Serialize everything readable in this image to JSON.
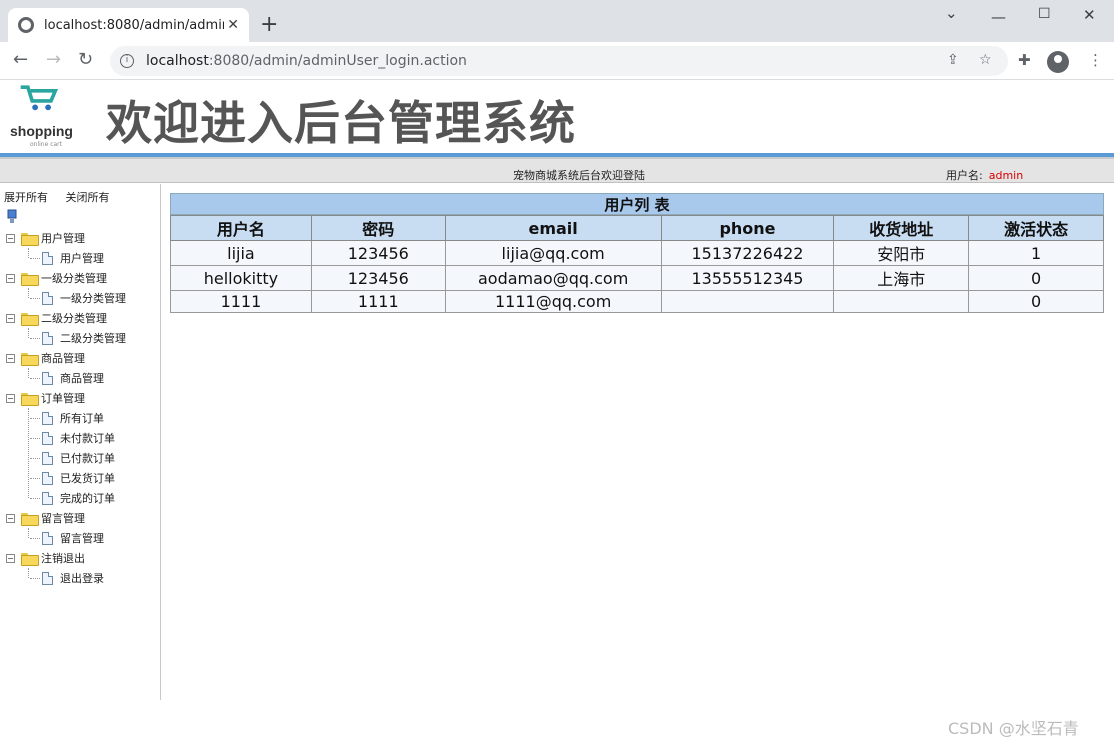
{
  "browser": {
    "tab_title": "localhost:8080/admin/adminU",
    "url_host": "localhost",
    "url_path": ":8080/admin/adminUser_login.action"
  },
  "header": {
    "logo_word": "shopping",
    "logo_sub": "online cart",
    "title": "欢迎进入后台管理系统"
  },
  "infobar": {
    "welcome": "宠物商城系统后台欢迎登陆",
    "user_label": "用户名:",
    "user_name": "admin"
  },
  "sidebar": {
    "expand_all": "展开所有",
    "collapse_all": "关闭所有",
    "groups": [
      {
        "label": "用户管理",
        "items": [
          "用户管理"
        ]
      },
      {
        "label": "一级分类管理",
        "items": [
          "一级分类管理"
        ]
      },
      {
        "label": "二级分类管理",
        "items": [
          "二级分类管理"
        ]
      },
      {
        "label": "商品管理",
        "items": [
          "商品管理"
        ]
      },
      {
        "label": "订单管理",
        "items": [
          "所有订单",
          "未付款订单",
          "已付款订单",
          "已发货订单",
          "完成的订单"
        ]
      },
      {
        "label": "留言管理",
        "items": [
          "留言管理"
        ]
      },
      {
        "label": "注销退出",
        "items": [
          "退出登录"
        ]
      }
    ]
  },
  "table": {
    "caption": "用户列 表",
    "columns": [
      "用户名",
      "密码",
      "email",
      "phone",
      "收货地址",
      "激活状态"
    ],
    "rows": [
      [
        "lijia",
        "123456",
        "lijia@qq.com",
        "15137226422",
        "安阳市",
        "1"
      ],
      [
        "hellokitty",
        "123456",
        "aodamao@qq.com",
        "13555512345",
        "上海市",
        "0"
      ],
      [
        "1111",
        "1111",
        "1111@qq.com",
        "",
        "",
        "0"
      ]
    ]
  },
  "watermark": "CSDN @水坚石青"
}
